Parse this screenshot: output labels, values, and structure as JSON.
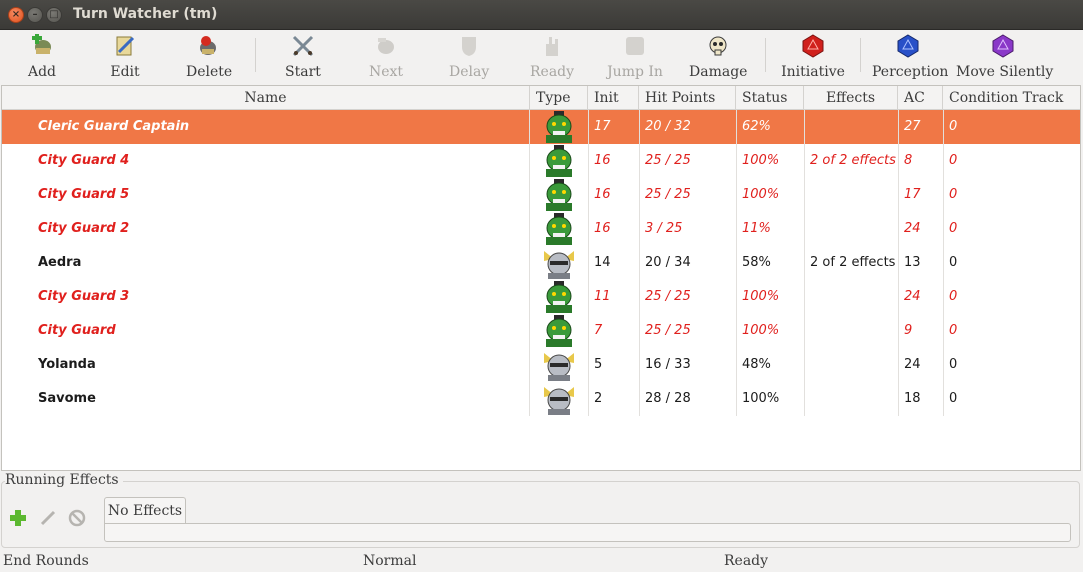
{
  "window": {
    "title": "Turn Watcher (tm)"
  },
  "toolbar": {
    "add": "Add",
    "edit": "Edit",
    "delete": "Delete",
    "start": "Start",
    "next": "Next",
    "delay": "Delay",
    "ready": "Ready",
    "jump_in": "Jump In",
    "damage": "Damage",
    "initiative": "Initiative",
    "perception": "Perception",
    "move_silently": "Move Silently"
  },
  "columns": {
    "name": "Name",
    "type": "Type",
    "init": "Init",
    "hit_points": "Hit Points",
    "status": "Status",
    "effects": "Effects",
    "ac": "AC",
    "condition_track": "Condition Track"
  },
  "rows": [
    {
      "name": "Cleric Guard Captain",
      "type": "orc-icon",
      "init": "17",
      "hp": "20 / 32",
      "status": "62%",
      "effects": "",
      "ac": "27",
      "ct": "0",
      "kind": "enemy",
      "selected": true
    },
    {
      "name": "City Guard 4",
      "type": "orc-icon",
      "init": "16",
      "hp": "25 / 25",
      "status": "100%",
      "effects": "2 of 2 effects",
      "ac": "8",
      "ct": "0",
      "kind": "enemy",
      "selected": false
    },
    {
      "name": "City Guard 5",
      "type": "orc-icon",
      "init": "16",
      "hp": "25 / 25",
      "status": "100%",
      "effects": "",
      "ac": "17",
      "ct": "0",
      "kind": "enemy",
      "selected": false
    },
    {
      "name": "City Guard 2",
      "type": "orc-icon",
      "init": "16",
      "hp": "3 / 25",
      "status": "11%",
      "effects": "",
      "ac": "24",
      "ct": "0",
      "kind": "enemy",
      "selected": false
    },
    {
      "name": "Aedra",
      "type": "knight-icon",
      "init": "14",
      "hp": "20 / 34",
      "status": "58%",
      "effects": "2 of 2 effects",
      "ac": "13",
      "ct": "0",
      "kind": "ally",
      "selected": false
    },
    {
      "name": "City Guard 3",
      "type": "orc-icon",
      "init": "11",
      "hp": "25 / 25",
      "status": "100%",
      "effects": "",
      "ac": "24",
      "ct": "0",
      "kind": "enemy",
      "selected": false
    },
    {
      "name": "City Guard",
      "type": "orc-icon",
      "init": "7",
      "hp": "25 / 25",
      "status": "100%",
      "effects": "",
      "ac": "9",
      "ct": "0",
      "kind": "enemy",
      "selected": false
    },
    {
      "name": "Yolanda",
      "type": "knight-icon",
      "init": "5",
      "hp": "16 / 33",
      "status": "48%",
      "effects": "",
      "ac": "24",
      "ct": "0",
      "kind": "ally",
      "selected": false
    },
    {
      "name": "Savome",
      "type": "knight-icon",
      "init": "2",
      "hp": "28 / 28",
      "status": "100%",
      "effects": "",
      "ac": "18",
      "ct": "0",
      "kind": "ally",
      "selected": false
    }
  ],
  "effects_panel": {
    "label": "Running Effects",
    "tab": "No Effects"
  },
  "statusbar": {
    "left": "End Rounds",
    "middle": "Normal",
    "right": "Ready"
  },
  "colors": {
    "selected_row": "#f07746",
    "enemy_text": "#e0201d",
    "ally_text": "#1c1c1c"
  }
}
